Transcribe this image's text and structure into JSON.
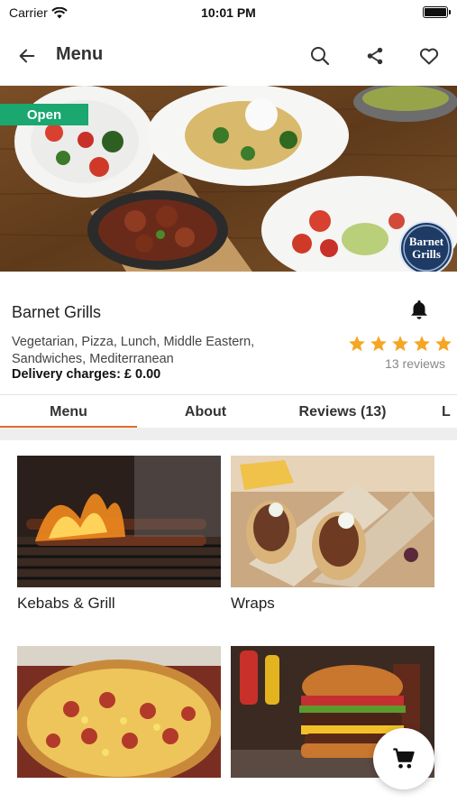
{
  "status_bar": {
    "carrier": "Carrier",
    "time": "10:01 PM"
  },
  "nav": {
    "title": "Menu",
    "back_icon": "arrow-left-icon",
    "search_icon": "search-icon",
    "share_icon": "share-icon",
    "favorite_icon": "heart-icon"
  },
  "hero": {
    "status_badge": "Open",
    "logo_text": "Barnet Grills"
  },
  "restaurant": {
    "name": "Barnet Grills",
    "cuisines": "Vegetarian, Pizza, Lunch, Middle Eastern, Sandwiches, Mediterranean",
    "delivery": "Delivery charges: £ 0.00",
    "rating": 5,
    "reviews": "13 reviews",
    "bell_icon": "bell-icon"
  },
  "tabs": [
    {
      "label": "Menu"
    },
    {
      "label": "About"
    },
    {
      "label": "Reviews (13)"
    },
    {
      "label": "L"
    }
  ],
  "categories": [
    {
      "label": "Kebabs & Grill"
    },
    {
      "label": "Wraps"
    },
    {
      "label": ""
    },
    {
      "label": ""
    }
  ],
  "colors": {
    "accent": "#e06c2f",
    "open_green": "#1aa770",
    "star": "#f5a623"
  },
  "cart_icon": "cart-icon"
}
